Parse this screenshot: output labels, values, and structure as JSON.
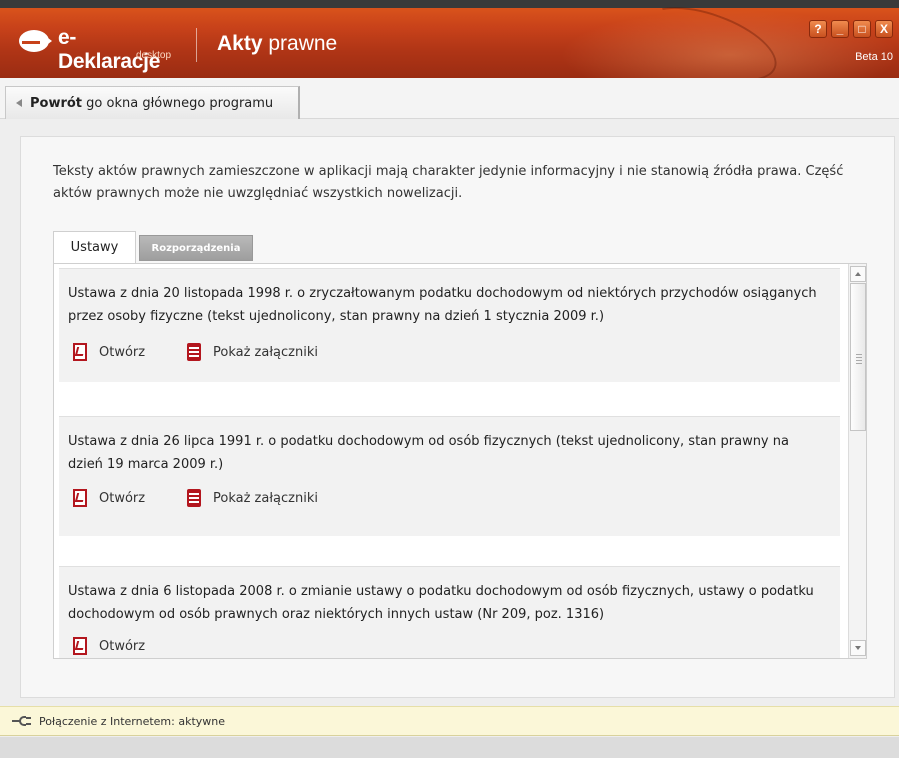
{
  "app": {
    "logo_text": "e-Deklaracje",
    "logo_sub": "desktop",
    "title_bold": "Akty",
    "title_rest": " prawne",
    "version": "Beta 10",
    "window_buttons": [
      "?",
      "_",
      "□",
      "X"
    ],
    "brand_color": "#c8421a"
  },
  "back": {
    "bold": "Powrót",
    "rest": " go okna głównego programu"
  },
  "disclaimer": "Teksty aktów prawnych zamieszczone w aplikacji mają charakter jedynie informacyjny i nie stanowią źródła prawa. Część aktów prawnych może nie uwzględniać wszystkich nowelizacji.",
  "tabs": [
    {
      "label": "Ustawy",
      "active": true
    },
    {
      "label": "Rozporządzenia",
      "active": false
    }
  ],
  "entries": [
    {
      "title": "Ustawa z dnia 20 listopada 1998 r. o zryczałtowanym podatku dochodowym od niektórych przychodów osiąganych przez osoby fizyczne (tekst ujednolicony, stan prawny na dzień 1 stycznia 2009 r.)",
      "open_label": "Otwórz",
      "attachments_label": "Pokaż załączniki"
    },
    {
      "title": "Ustawa z dnia 26 lipca 1991 r. o podatku dochodowym od osób fizycznych (tekst ujednolicony, stan prawny na dzień 19 marca 2009 r.)",
      "open_label": "Otwórz",
      "attachments_label": "Pokaż załączniki"
    },
    {
      "title": "Ustawa z dnia 6 listopada 2008 r. o zmianie ustawy o podatku dochodowym od osób fizycznych, ustawy o podatku dochodowym od osób prawnych oraz niektórych innych ustaw (Nr 209, poz. 1316)",
      "open_label": "Otwórz"
    }
  ],
  "status": {
    "text": "Połączenie z Internetem: aktywne",
    "icon": "plug-icon"
  }
}
